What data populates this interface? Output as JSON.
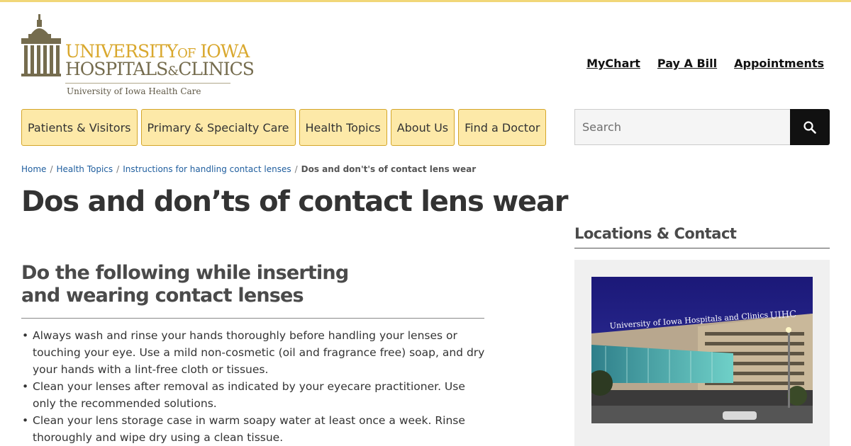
{
  "logo": {
    "line1_a": "UNIVERSITY",
    "line1_b": "OF",
    "line1_c": "IOWA",
    "line2_a": "HOSPITALS",
    "line2_b": "&",
    "line2_c": "CLINICS",
    "subtitle": "University of Iowa Health Care",
    "colors": {
      "gold": "#d9a82e",
      "brown": "#756c4e"
    }
  },
  "utility_links": [
    "MyChart",
    "Pay A Bill",
    "Appointments"
  ],
  "nav": [
    "Patients & Visitors",
    "Primary & Specialty Care",
    "Health Topics",
    "About Us",
    "Find a Doctor"
  ],
  "search": {
    "placeholder": "Search",
    "icon": "search-icon"
  },
  "breadcrumb": {
    "items": [
      "Home",
      "Health Topics",
      "Instructions for handling contact lenses"
    ],
    "current": "Dos and don't's of contact lens wear",
    "separator": "/"
  },
  "page": {
    "title": "Dos and don’ts of contact lens wear",
    "section_heading": "Do the following while inserting and wearing contact lenses",
    "items": [
      "Always wash and rinse your hands thoroughly before handling your lenses or touching your eye. Use a mild non-cosmetic (oil and fragrance free) soap, and dry your hands with a lint-free cloth or tissues.",
      "Clean your lenses after removal as indicated by your eyecare practitioner. Use only the recommended solutions.",
      "Clean your lens storage case in warm soapy water at least once a week. Rinse thoroughly and wipe dry using a clean tissue."
    ]
  },
  "sidebar": {
    "title": "Locations & Contact",
    "photo": {
      "sign_text": "University of Iowa Hospitals and Clinics",
      "sign_logo": "UIHC"
    }
  },
  "colors": {
    "nav_bg": "#fde9a8",
    "nav_border": "#d4a62a",
    "link": "#1f5e9e",
    "top_bar": "#f1d778"
  }
}
